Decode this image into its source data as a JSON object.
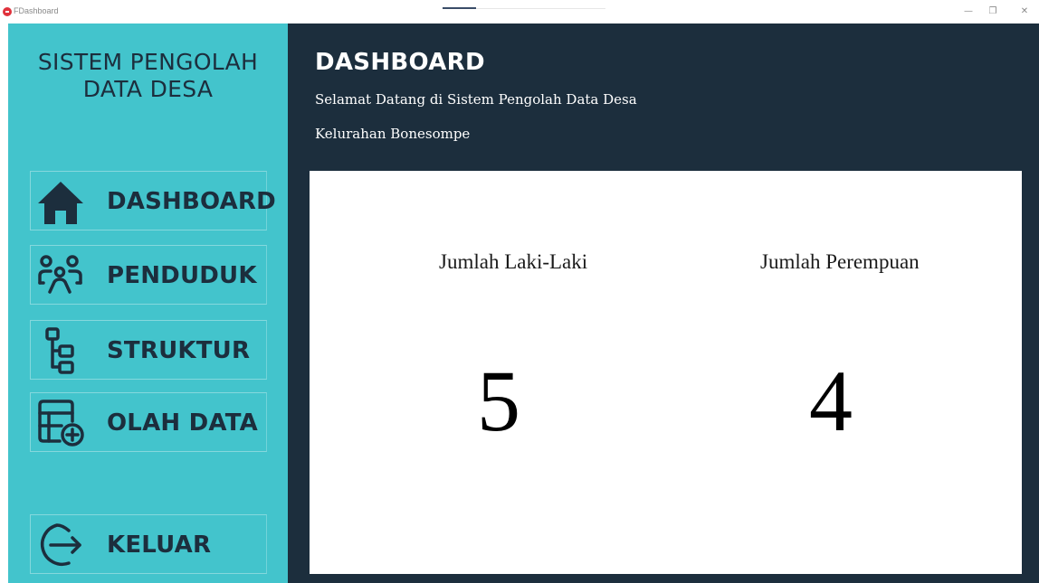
{
  "window": {
    "title": "FDashboard",
    "controls": {
      "minimize": "—",
      "maximize": "❐",
      "close": "✕"
    }
  },
  "sidebar": {
    "title": "SISTEM PENGOLAH\nDATA DESA",
    "items": [
      {
        "label": "DASHBOARD",
        "icon": "home-icon"
      },
      {
        "label": "PENDUDUK",
        "icon": "people-icon"
      },
      {
        "label": "STRUKTUR",
        "icon": "hierarchy-icon"
      },
      {
        "label": "OLAH DATA",
        "icon": "add-table-icon"
      },
      {
        "label": "KELUAR",
        "icon": "logout-icon"
      }
    ]
  },
  "main": {
    "title": "DASHBOARD",
    "welcome": "Selamat Datang di Sistem Pengolah Data Desa",
    "kelurahan": "Kelurahan Bonesompe",
    "stats": {
      "male_label": "Jumlah Laki-Laki",
      "male_value": "5",
      "female_label": "Jumlah Perempuan",
      "female_value": "4"
    }
  },
  "colors": {
    "sidebar_bg": "#43c4cc",
    "main_bg": "#1c2e3d",
    "icon_color": "#1c2e3d",
    "app_icon": "#e0323c"
  }
}
